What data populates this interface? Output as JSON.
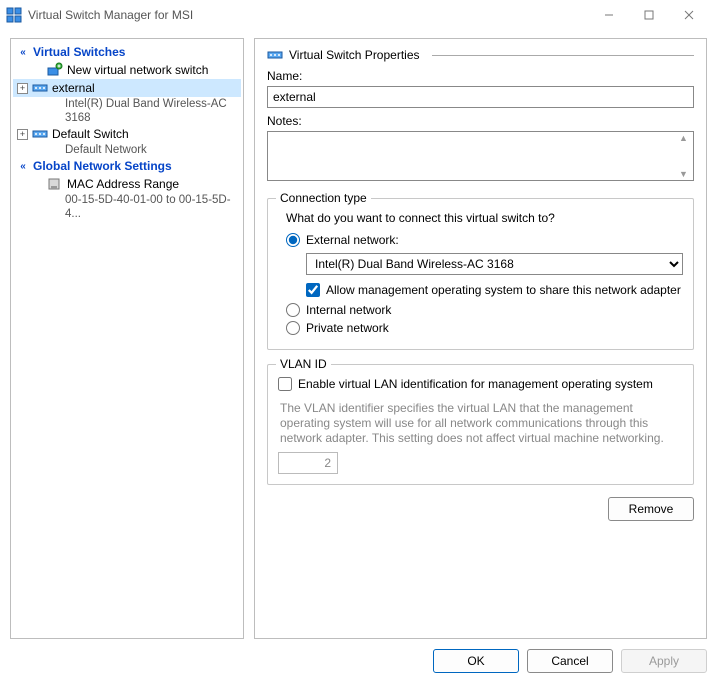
{
  "window": {
    "title": "Virtual Switch Manager for MSI"
  },
  "tree": {
    "section_switches": "Virtual Switches",
    "new_switch": "New virtual network switch",
    "items": [
      {
        "name": "external",
        "detail": "Intel(R) Dual Band Wireless-AC 3168"
      },
      {
        "name": "Default Switch",
        "detail": "Default Network"
      }
    ],
    "section_global": "Global Network Settings",
    "mac_range": {
      "name": "MAC Address Range",
      "detail": "00-15-5D-40-01-00 to 00-15-5D-4..."
    }
  },
  "props": {
    "header": "Virtual Switch Properties",
    "name_label": "Name:",
    "name_value": "external",
    "notes_label": "Notes:",
    "notes_value": ""
  },
  "conn": {
    "legend": "Connection type",
    "prompt": "What do you want to connect this virtual switch to?",
    "external_label": "External network:",
    "adapter_selected": "Intel(R) Dual Band Wireless-AC 3168",
    "allow_mgmt_label": "Allow management operating system to share this network adapter",
    "internal_label": "Internal network",
    "private_label": "Private network"
  },
  "vlan": {
    "legend": "VLAN ID",
    "enable_label": "Enable virtual LAN identification for management operating system",
    "help": "The VLAN identifier specifies the virtual LAN that the management operating system will use for all network communications through this network adapter. This setting does not affect virtual machine networking.",
    "value": "2"
  },
  "buttons": {
    "remove": "Remove",
    "ok": "OK",
    "cancel": "Cancel",
    "apply": "Apply"
  }
}
